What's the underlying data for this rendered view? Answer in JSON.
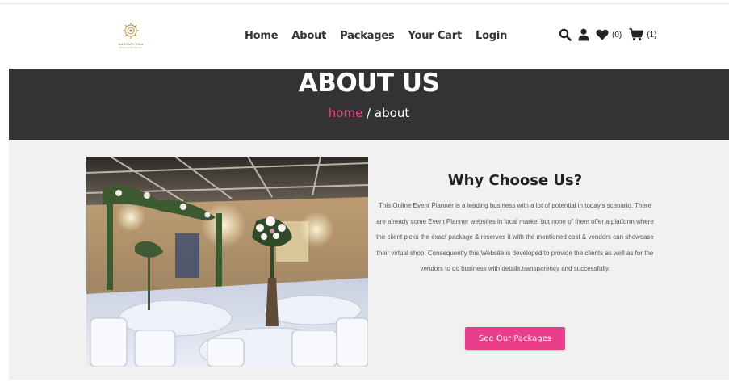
{
  "brand": {
    "logo_text": "KARYAPURNA",
    "logo_subtext": "Online Event Planner"
  },
  "nav": {
    "items": [
      {
        "label": "Home"
      },
      {
        "label": "About"
      },
      {
        "label": "Packages"
      },
      {
        "label": "Your Cart"
      },
      {
        "label": "Login"
      }
    ]
  },
  "header_icons": {
    "search": "search-icon",
    "user": "user-icon",
    "wishlist": "heart-icon",
    "wishlist_count": "(0)",
    "cart": "cart-icon",
    "cart_count": "(1)"
  },
  "banner": {
    "title": "ABOUT US",
    "breadcrumb_home": "home",
    "breadcrumb_sep": " / ",
    "breadcrumb_current": "about"
  },
  "about": {
    "title": "Why Choose Us?",
    "body": "This Online Event Planner is a leading business with a lot of potential in today's scenario. There are already some Event Planner websites in local market but none of them offer a platform where the client picks the exact package & reserves it with the mentioned cost & vendors can showcase their virtual shop. Consequently this Website is developed to provide the clients as well as for the vendors to do business with details,transparency and successfully.",
    "cta_label": "See Our Packages"
  },
  "colors": {
    "accent": "#e83e8c",
    "banner_bg": "#333333",
    "content_bg": "#f1f1f1"
  }
}
